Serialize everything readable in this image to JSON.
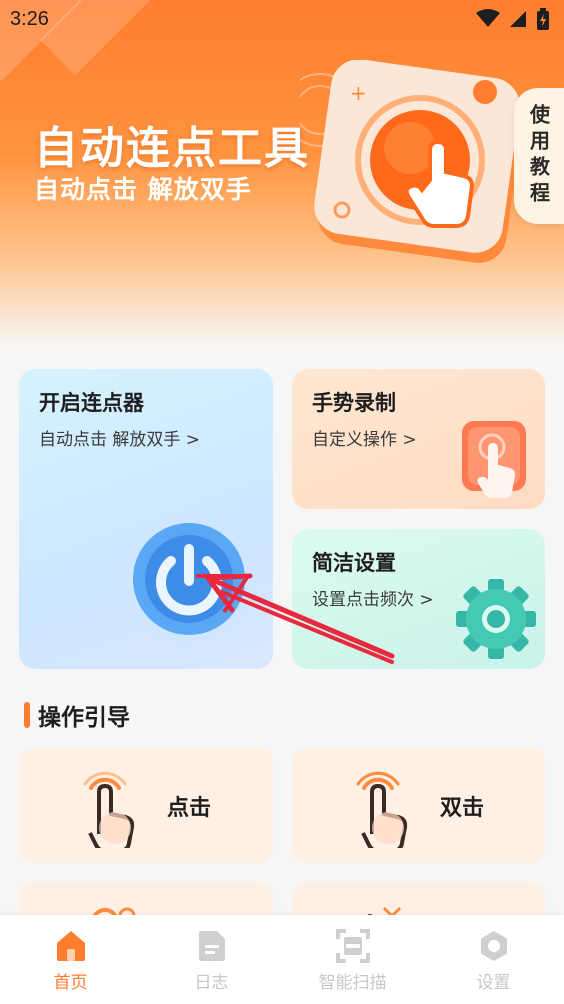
{
  "status_bar": {
    "time": "3:26"
  },
  "banner": {
    "title": "自动连点工具",
    "subtitle": "自动点击 解放双手",
    "tutorial_label": "使用教程"
  },
  "cards": {
    "start": {
      "title": "开启连点器",
      "subtitle": "自动点击 解放双手 >"
    },
    "gesture": {
      "title": "手势录制",
      "subtitle": "自定义操作 >"
    },
    "settings": {
      "title": "简洁设置",
      "subtitle": "设置点击频次 >"
    }
  },
  "guide": {
    "section_title": "操作引导",
    "items": [
      {
        "label": "点击"
      },
      {
        "label": "双击"
      }
    ]
  },
  "nav": {
    "items": [
      {
        "label": "首页",
        "icon": "home-icon",
        "active": true
      },
      {
        "label": "日志",
        "icon": "document-icon",
        "active": false
      },
      {
        "label": "智能扫描",
        "icon": "scan-icon",
        "active": false
      },
      {
        "label": "设置",
        "icon": "settings-icon",
        "active": false
      }
    ]
  },
  "colors": {
    "accent": "#ff7d2e",
    "annotation": "#e8283c"
  }
}
